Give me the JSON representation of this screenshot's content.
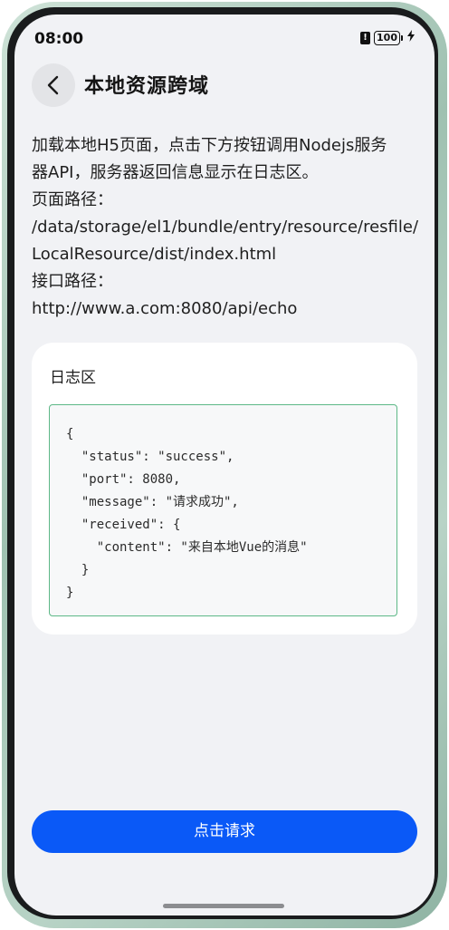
{
  "status_bar": {
    "time": "08:00",
    "battery_level": "100",
    "alert_symbol": "!",
    "icons": [
      "alert-icon",
      "battery-icon",
      "charging-bolt-icon"
    ]
  },
  "header": {
    "back_icon": "chevron-left-icon",
    "title": "本地资源跨域"
  },
  "description": {
    "line1": "加载本地H5页面，点击下方按钮调用Nodejs服务",
    "line2": "器API，服务器返回信息显示在日志区。",
    "page_path_label": "页面路径：",
    "page_path_line1": "/data/storage/el1/bundle/entry/resource/resfile/",
    "page_path_line2": "LocalResource/dist/index.html",
    "api_path_label": "接口路径：",
    "api_path": "http://www.a.com:8080/api/echo"
  },
  "log": {
    "title": "日志区",
    "content": "{\n  \"status\": \"success\",\n  \"port\": 8080,\n  \"message\": \"请求成功\",\n  \"received\": {\n    \"content\": \"来自本地Vue的消息\"\n  }\n}"
  },
  "action": {
    "request_label": "点击请求"
  },
  "colors": {
    "accent": "#0a59f7",
    "log_border": "#5db887",
    "screen_bg": "#f1f2f5"
  }
}
